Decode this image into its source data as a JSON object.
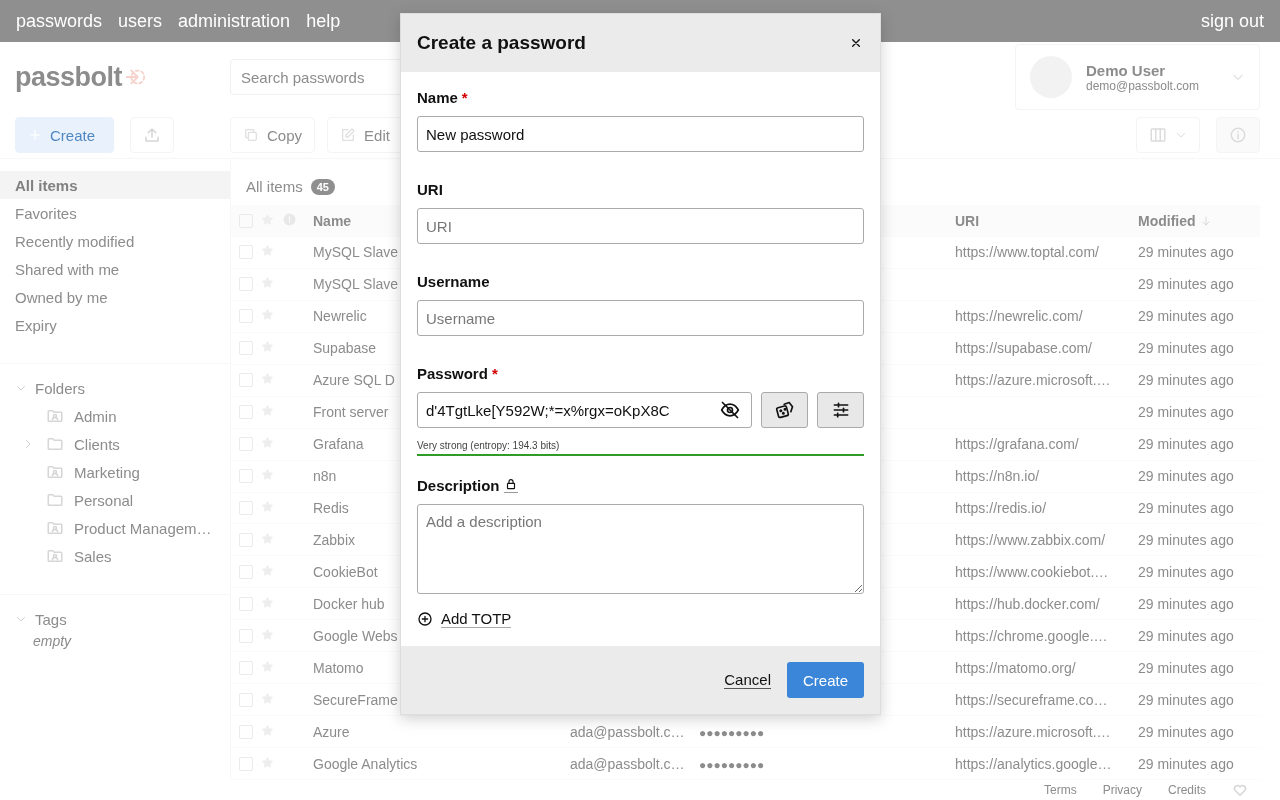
{
  "nav": [
    {
      "label": "passwords"
    },
    {
      "label": "users"
    },
    {
      "label": "administration"
    },
    {
      "label": "help"
    }
  ],
  "sign_out": "sign out",
  "logo": "passbolt",
  "search": {
    "placeholder": "Search passwords"
  },
  "user": {
    "name": "Demo User",
    "email": "demo@passbolt.com"
  },
  "actions": {
    "create": "Create",
    "copy": "Copy",
    "edit": "Edit"
  },
  "filters": [
    {
      "label": "All items",
      "selected": true
    },
    {
      "label": "Favorites",
      "selected": false
    },
    {
      "label": "Recently modified",
      "selected": false
    },
    {
      "label": "Shared with me",
      "selected": false
    },
    {
      "label": "Owned by me",
      "selected": false
    },
    {
      "label": "Expiry",
      "selected": false
    }
  ],
  "folders": {
    "label": "Folders",
    "expanded": true,
    "children": [
      {
        "name": "Admin",
        "kind": "shared",
        "has_children": false
      },
      {
        "name": "Clients",
        "kind": "private",
        "has_children": true
      },
      {
        "name": "Marketing",
        "kind": "shared",
        "has_children": false
      },
      {
        "name": "Personal",
        "kind": "private",
        "has_children": false
      },
      {
        "name": "Product Managem…",
        "kind": "shared",
        "has_children": false
      },
      {
        "name": "Sales",
        "kind": "shared",
        "has_children": false
      }
    ]
  },
  "tags": {
    "label": "Tags",
    "expanded": true,
    "empty_text": "empty"
  },
  "breadcrumb": {
    "label": "All items",
    "count": "45"
  },
  "table": {
    "all_checked": false,
    "columns": {
      "name": "Name",
      "uri": "URI",
      "modified": "Modified"
    },
    "rows": [
      {
        "name": "MySQL Slave",
        "uri": "https://www.toptal.com/",
        "modified": "29 minutes ago",
        "checked": false
      },
      {
        "name": "MySQL Slave",
        "modified": "29 minutes ago",
        "checked": false
      },
      {
        "name": "Newrelic",
        "uri": "https://newrelic.com/",
        "modified": "29 minutes ago",
        "checked": false
      },
      {
        "name": "Supabase",
        "uri": "https://supabase.com/",
        "modified": "29 minutes ago",
        "checked": false
      },
      {
        "name": "Azure SQL D",
        "uri": "https://azure.microsoft.…",
        "modified": "29 minutes ago",
        "checked": false
      },
      {
        "name": "Front server",
        "modified": "29 minutes ago",
        "checked": false
      },
      {
        "name": "Grafana",
        "uri": "https://grafana.com/",
        "modified": "29 minutes ago",
        "checked": false
      },
      {
        "name": "n8n",
        "uri": "https://n8n.io/",
        "modified": "29 minutes ago",
        "checked": false
      },
      {
        "name": "Redis",
        "uri": "https://redis.io/",
        "modified": "29 minutes ago",
        "checked": false
      },
      {
        "name": "Zabbix",
        "uri": "https://www.zabbix.com/",
        "modified": "29 minutes ago",
        "checked": false
      },
      {
        "name": "CookieBot",
        "uri": "https://www.cookiebot.…",
        "modified": "29 minutes ago",
        "checked": false
      },
      {
        "name": "Docker hub",
        "uri": "https://hub.docker.com/",
        "modified": "29 minutes ago",
        "checked": false
      },
      {
        "name": "Google Webs",
        "uri": "https://chrome.google.…",
        "modified": "29 minutes ago",
        "checked": false
      },
      {
        "name": "Matomo",
        "uri": "https://matomo.org/",
        "modified": "29 minutes ago",
        "checked": false
      },
      {
        "name": "SecureFrame",
        "uri": "https://secureframe.co…",
        "modified": "29 minutes ago",
        "checked": false
      },
      {
        "name": "Azure",
        "username": "ada@passbolt.c…",
        "password": "●●●●●●●●●",
        "uri": "https://azure.microsoft.…",
        "modified": "29 minutes ago",
        "checked": false
      },
      {
        "name": "Google Analytics",
        "username": "ada@passbolt.c…",
        "password": "●●●●●●●●●",
        "uri": "https://analytics.google…",
        "modified": "29 minutes ago",
        "checked": false
      }
    ]
  },
  "footer": [
    {
      "label": "Terms"
    },
    {
      "label": "Privacy"
    },
    {
      "label": "Credits"
    }
  ],
  "dialog": {
    "title": "Create a password",
    "fields": [
      {
        "label": "Name",
        "required_mark": "*",
        "value": "New password"
      },
      {
        "label": "URI",
        "placeholder": "URI"
      },
      {
        "label": "Username",
        "placeholder": "Username"
      }
    ],
    "password": {
      "label": "Password",
      "required_mark": "*",
      "value": "d'4TgtLke[Y592W;*=x%rgx=oKpX8C",
      "strength": "Very strong (entropy: 194.3 bits)",
      "level": 1
    },
    "description": {
      "label": "Description",
      "placeholder": "Add a description"
    },
    "add_totp": "Add TOTP",
    "buttons": [
      {
        "label": "Cancel",
        "kind": "link"
      },
      {
        "label": "Create",
        "kind": "primary"
      }
    ]
  }
}
